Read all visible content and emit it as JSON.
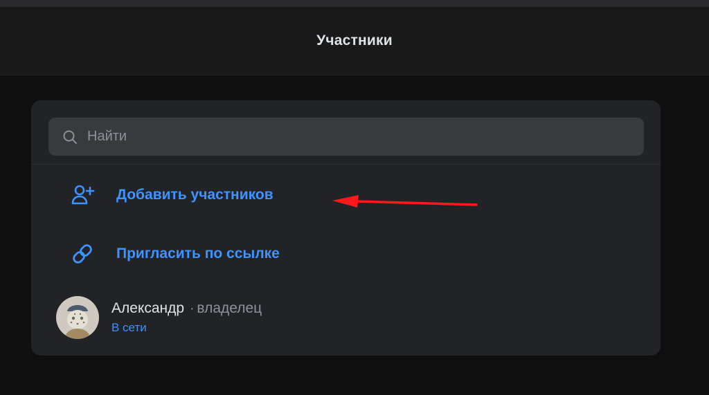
{
  "header": {
    "title": "Участники"
  },
  "search": {
    "placeholder": "Найти",
    "value": ""
  },
  "actions": [
    {
      "label": "Добавить участников",
      "icon": "user-plus-icon"
    },
    {
      "label": "Пригласить по ссылке",
      "icon": "link-icon"
    }
  ],
  "members": [
    {
      "name": "Александр",
      "separator": "·",
      "role": "владелец",
      "status": "В сети",
      "avatar": "snow-leopard-avatar"
    }
  ],
  "colors": {
    "accent": "#3d93ff",
    "panel": "#222327",
    "background": "#0f0f10",
    "annotation_arrow": "#ff1a1a"
  }
}
